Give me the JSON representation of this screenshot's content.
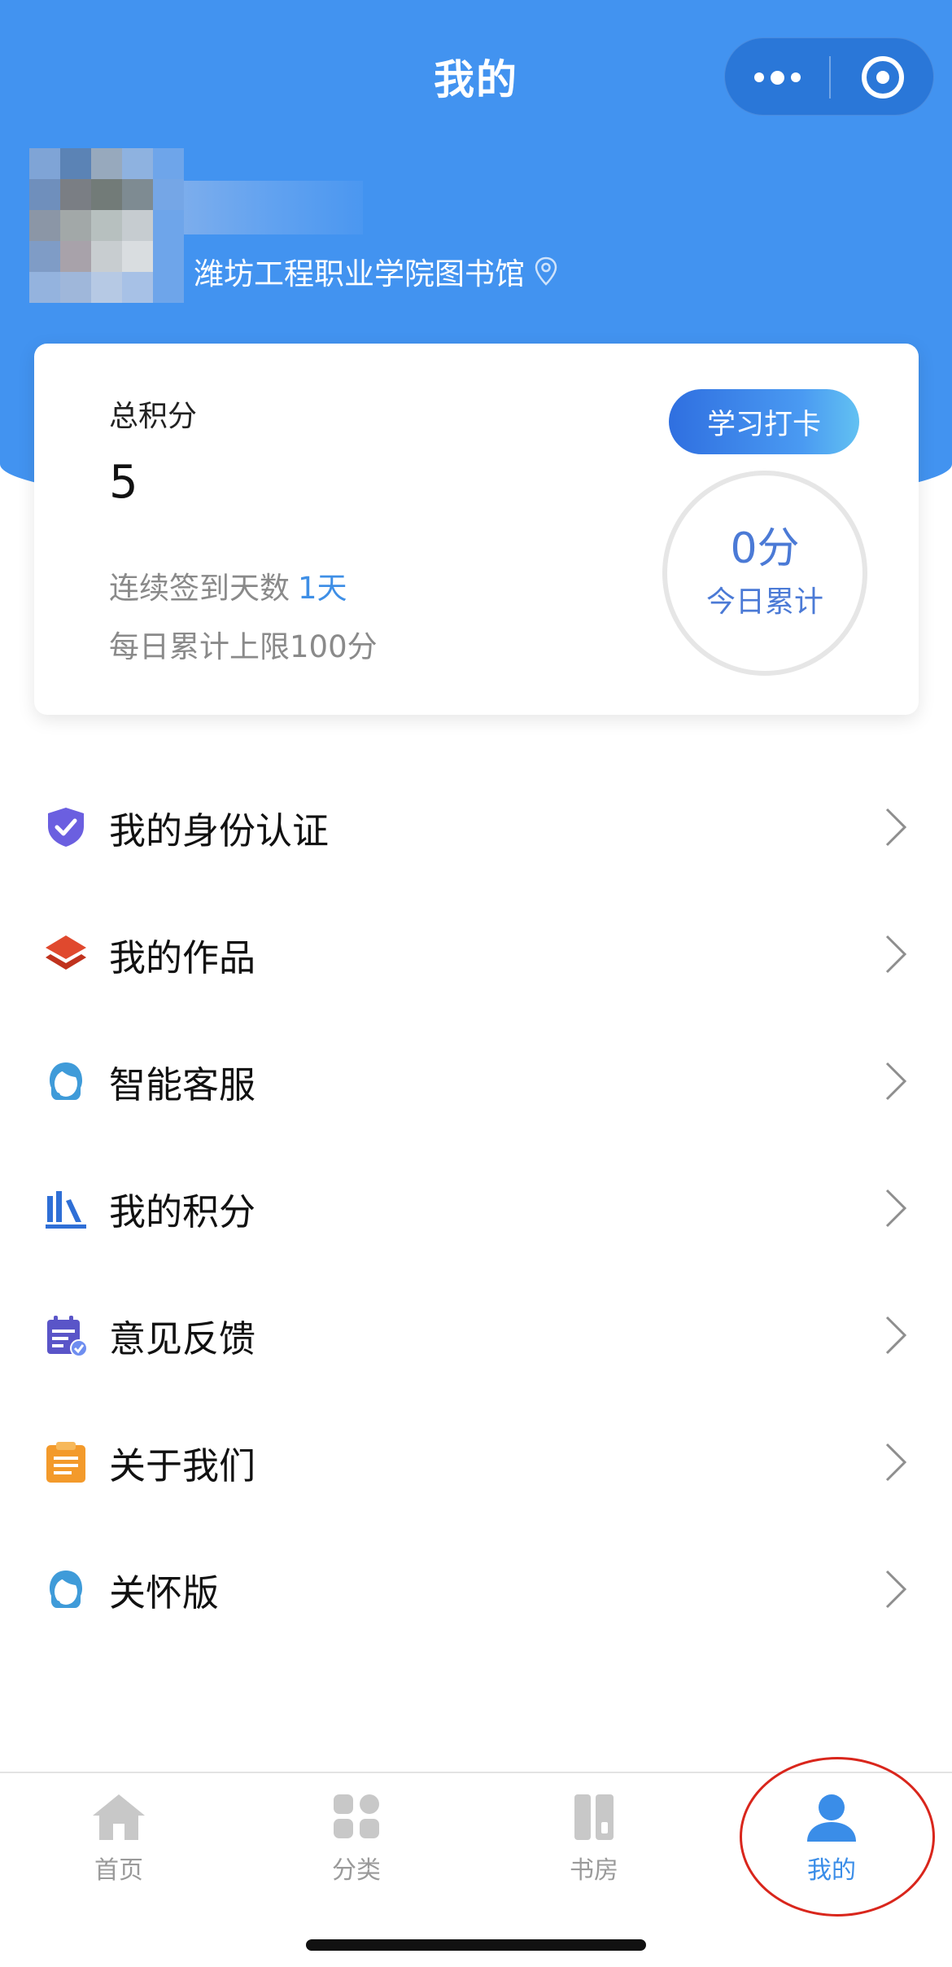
{
  "header": {
    "title": "我的",
    "more_icon": "more-dots-icon",
    "close_icon": "target-close-icon",
    "brand_color": "#4293F0"
  },
  "profile": {
    "avatar": "pixelated-avatar",
    "organization": "潍坊工程职业学院图书馆",
    "location_icon": "location-pin-icon"
  },
  "score_card": {
    "total_label": "总积分",
    "total_value": "5",
    "streak_label": "连续签到天数",
    "streak_value": "1天",
    "daily_limit": "每日累计上限100分",
    "checkin_button": "学习打卡",
    "today_value": "0分",
    "today_label": "今日累计"
  },
  "menu": [
    {
      "label": "我的身份认证",
      "icon": "shield-check-icon"
    },
    {
      "label": "我的作品",
      "icon": "layers-icon"
    },
    {
      "label": "智能客服",
      "icon": "customer-service-icon"
    },
    {
      "label": "我的积分",
      "icon": "bar-chart-icon"
    },
    {
      "label": "意见反馈",
      "icon": "feedback-calendar-icon"
    },
    {
      "label": "关于我们",
      "icon": "clipboard-icon"
    },
    {
      "label": "关怀版",
      "icon": "customer-service-icon"
    }
  ],
  "tabbar": {
    "items": [
      {
        "label": "首页",
        "icon": "home-icon"
      },
      {
        "label": "分类",
        "icon": "category-grid-icon"
      },
      {
        "label": "书房",
        "icon": "bookshelf-icon"
      },
      {
        "label": "我的",
        "icon": "user-icon",
        "active": true
      }
    ],
    "active_color": "#3a8de8"
  }
}
